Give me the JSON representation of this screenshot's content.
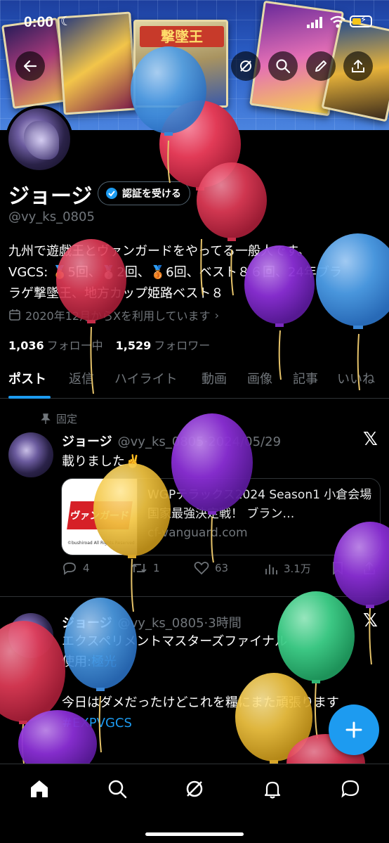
{
  "status_bar": {
    "time": "0:00"
  },
  "banner": {
    "card_title": "撃墜王"
  },
  "profile": {
    "name": "ジョージ",
    "verify_label": "認証を受ける",
    "handle": "@vy_ks_0805",
    "bio_line1": "九州で遊戯王とヴァンガードをやってる一般人です。",
    "bio_line2": "VGCS: 🥇5回、🥈2回、🥉6回、ベスト８６回、24年ブラ",
    "bio_line3": "ラゲ撃墜王、地方カップ姫路ベスト８",
    "joined": "2020年12月からXを利用しています",
    "following_count": "1,036",
    "following_label": "フォロー中",
    "followers_count": "1,529",
    "followers_label": "フォロワー"
  },
  "tabs": [
    {
      "label": "ポスト"
    },
    {
      "label": "返信"
    },
    {
      "label": "ハイライト"
    },
    {
      "label": "動画"
    },
    {
      "label": "画像"
    },
    {
      "label": "記事"
    },
    {
      "label": "いいね"
    }
  ],
  "posts": [
    {
      "pinned_label": "固定",
      "author": "ジョージ",
      "meta": "@vy_ks_0805·2024/05/29",
      "text": "載りました✌️",
      "link": {
        "thumb_logo": "ヴァンガード",
        "thumb_caption": "©bushiroad All Rights Reserved",
        "title": "WGPテラックス2024 Season1 小倉会場 国家最強決定戦！ ブラン…",
        "domain": "cf-vanguard.com"
      },
      "replies": "4",
      "reposts": "1",
      "likes": "63",
      "views": "3.1万"
    },
    {
      "author": "ジョージ",
      "meta": "@vy_ks_0805·3時間",
      "line1": "エクスペリメントマスターズファイナル",
      "line2_prefix": "使用:",
      "line2_tag": "極光",
      "line3": "今日はダメだったけどこれを糧にまた頑張ります",
      "hashtag": "#EXPVGCS"
    }
  ],
  "colors": {
    "accent": "#1d9bf0",
    "background": "#000000",
    "muted_text": "#71767b",
    "balloon_red": "#e23b57",
    "balloon_blue": "#4d9ee8",
    "balloon_purple": "#8b2fd6",
    "balloon_yellow": "#f2c542",
    "balloon_green": "#3fd18a"
  },
  "icons": [
    "back-arrow-icon",
    "grok-icon",
    "search-icon",
    "edit-icon",
    "share-icon",
    "calendar-icon",
    "chevron-right-icon",
    "pin-icon",
    "x-logo-icon",
    "reply-icon",
    "repost-icon",
    "like-icon",
    "views-icon",
    "bookmark-icon",
    "compose-plus-icon",
    "home-icon",
    "notifications-icon",
    "messages-icon"
  ]
}
